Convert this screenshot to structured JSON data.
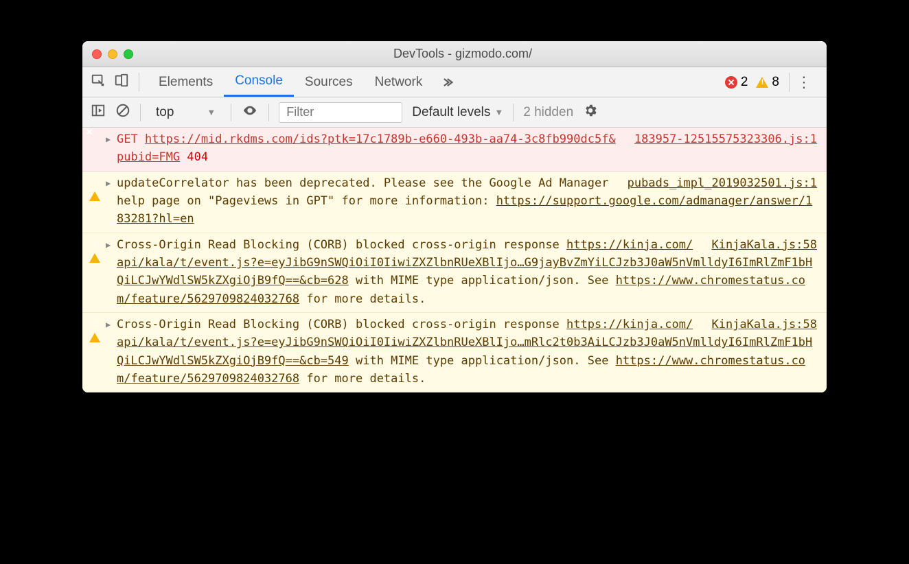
{
  "window": {
    "title": "DevTools - gizmodo.com/"
  },
  "tabs": {
    "items": [
      "Elements",
      "Console",
      "Sources",
      "Network"
    ],
    "active_index": 1
  },
  "badges": {
    "errors": "2",
    "warnings": "8"
  },
  "filterbar": {
    "context": "top",
    "filter_placeholder": "Filter",
    "level_label": "Default levels",
    "hidden_label": "2 hidden"
  },
  "messages": [
    {
      "type": "error",
      "parts": [
        {
          "t": "plain",
          "v": "GET ",
          "cls": "get-label"
        },
        {
          "t": "link",
          "v": "https://mid.rkdms.com/ids?ptk=17c1789b-e660-493b-aa74-3c8fb990dc5f&pubid=FMG"
        },
        {
          "t": "plain",
          "v": " "
        },
        {
          "t": "plain",
          "v": "404",
          "cls": "status-404"
        }
      ],
      "source": "183957-12515575323306.js:1"
    },
    {
      "type": "warn",
      "parts": [
        {
          "t": "plain",
          "v": "updateCorrelator has been deprecated. Please see the Google Ad Manager help page on \"Pageviews in GPT\" for more information: "
        },
        {
          "t": "link",
          "v": "https://support.google.com/admanager/answer/183281?hl=en"
        }
      ],
      "source": "pubads_impl_2019032501.js:1"
    },
    {
      "type": "warn",
      "parts": [
        {
          "t": "plain",
          "v": "Cross-Origin Read Blocking (CORB) blocked cross-origin response "
        },
        {
          "t": "link",
          "v": "https://kinja.com/api/kala/t/event.js?e=eyJibG9nSWQiOiI0IiwiZXZlbnRUeXBlIjo…G9jayBvZmYiLCJzb3J0aW5nVmlldyI6ImRlZmF1bHQiLCJwYWdlSW5kZXgiOjB9fQ==&cb=628"
        },
        {
          "t": "plain",
          "v": " with MIME type application/json. See "
        },
        {
          "t": "link",
          "v": "https://www.chromestatus.com/feature/5629709824032768"
        },
        {
          "t": "plain",
          "v": " for more details."
        }
      ],
      "source": "KinjaKala.js:58"
    },
    {
      "type": "warn",
      "parts": [
        {
          "t": "plain",
          "v": "Cross-Origin Read Blocking (CORB) blocked cross-origin response "
        },
        {
          "t": "link",
          "v": "https://kinja.com/api/kala/t/event.js?e=eyJibG9nSWQiOiI0IiwiZXZlbnRUeXBlIjo…mRlc2t0b3AiLCJzb3J0aW5nVmlldyI6ImRlZmF1bHQiLCJwYWdlSW5kZXgiOjB9fQ==&cb=549"
        },
        {
          "t": "plain",
          "v": " with MIME type application/json. See "
        },
        {
          "t": "link",
          "v": "https://www.chromestatus.com/feature/5629709824032768"
        },
        {
          "t": "plain",
          "v": " for more details."
        }
      ],
      "source": "KinjaKala.js:58"
    }
  ]
}
